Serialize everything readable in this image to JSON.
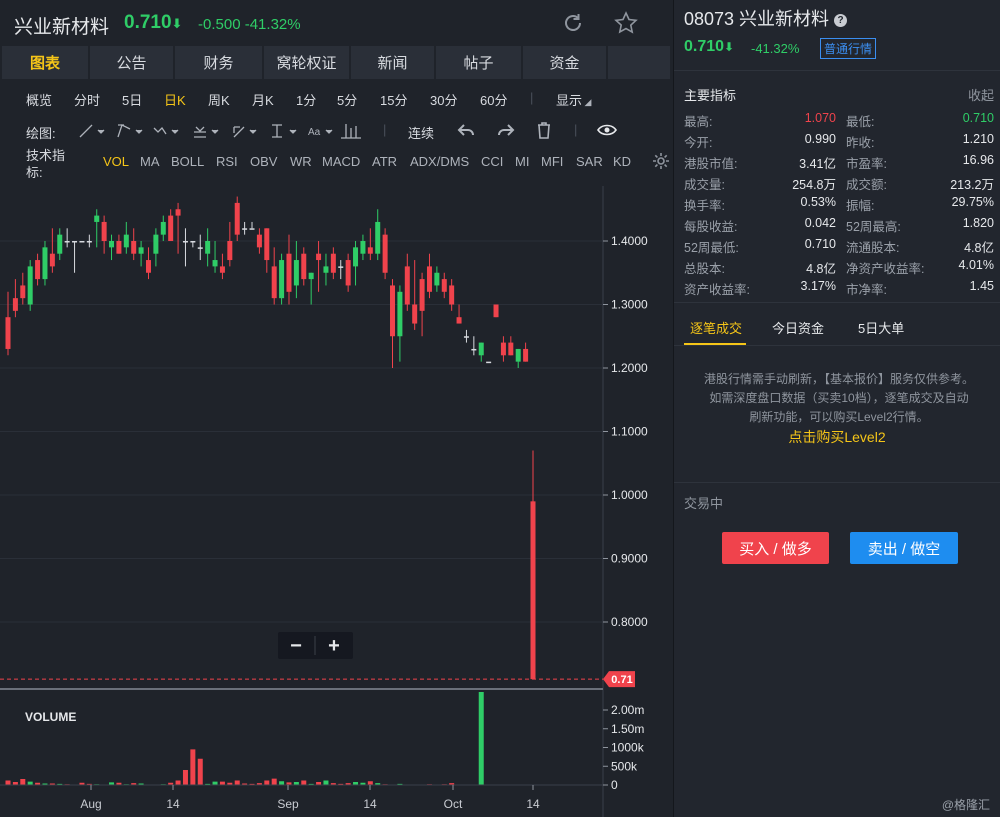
{
  "header": {
    "name": "兴业新材料",
    "price": "0.710",
    "price_arrow": "⬇",
    "change": "-0.500",
    "change_pct": "-41.32%"
  },
  "tabs": [
    {
      "label": "图表",
      "active": true
    },
    {
      "label": "公告"
    },
    {
      "label": "财务"
    },
    {
      "label": "窝轮权证"
    },
    {
      "label": "新闻"
    },
    {
      "label": "帖子"
    },
    {
      "label": "资金"
    }
  ],
  "periods": [
    {
      "label": "概览"
    },
    {
      "label": "分时"
    },
    {
      "label": "5日"
    },
    {
      "label": "日K",
      "active": true
    },
    {
      "label": "周K"
    },
    {
      "label": "月K"
    },
    {
      "label": "1分"
    },
    {
      "label": "5分"
    },
    {
      "label": "15分"
    },
    {
      "label": "30分"
    },
    {
      "label": "60分"
    },
    {
      "label": "显示"
    }
  ],
  "draw": {
    "label": "绘图:",
    "continuous": "连续"
  },
  "indicators": {
    "label": "技术指标:",
    "items": [
      "VOL",
      "MA",
      "BOLL",
      "RSI",
      "OBV",
      "WR",
      "MACD",
      "ATR",
      "ADX/DMS",
      "CCI",
      "MI",
      "MFI",
      "SAR",
      "KD"
    ],
    "active": "VOL"
  },
  "chart_data": {
    "type": "candlestick",
    "price_axis": {
      "ticks": [
        "1.4000",
        "1.3000",
        "1.2000",
        "1.1000",
        "1.0000",
        "0.9000",
        "0.8000"
      ],
      "values": [
        1.4,
        1.3,
        1.2,
        1.1,
        1.0,
        0.9,
        0.8
      ],
      "last_label": "0.71",
      "last": 0.71
    },
    "volume_axis": {
      "label": "VOLUME",
      "ticks": [
        "2.00m",
        "1.50m",
        "1000k",
        "500k",
        "0"
      ],
      "values": [
        2000000,
        1500000,
        1000000,
        500000,
        0
      ]
    },
    "x_labels": [
      "Aug",
      "14",
      "Sep",
      "14",
      "Oct",
      "14"
    ],
    "zoom": {
      "minus": "−",
      "plus": "+"
    },
    "candles": [
      {
        "o": 1.28,
        "h": 1.32,
        "l": 1.22,
        "c": 1.23
      },
      {
        "o": 1.31,
        "h": 1.34,
        "l": 1.28,
        "c": 1.29
      },
      {
        "o": 1.33,
        "h": 1.35,
        "l": 1.3,
        "c": 1.31
      },
      {
        "o": 1.3,
        "h": 1.37,
        "l": 1.29,
        "c": 1.36
      },
      {
        "o": 1.37,
        "h": 1.38,
        "l": 1.33,
        "c": 1.34
      },
      {
        "o": 1.34,
        "h": 1.4,
        "l": 1.33,
        "c": 1.39
      },
      {
        "o": 1.38,
        "h": 1.42,
        "l": 1.35,
        "c": 1.36
      },
      {
        "o": 1.38,
        "h": 1.42,
        "l": 1.37,
        "c": 1.41
      },
      {
        "o": 1.4,
        "h": 1.42,
        "l": 1.39,
        "c": 1.4
      },
      {
        "o": 1.4,
        "h": 1.4,
        "l": 1.35,
        "c": 1.4
      },
      {
        "o": 1.4,
        "h": 1.4,
        "l": 1.4,
        "c": 1.4
      },
      {
        "o": 1.4,
        "h": 1.41,
        "l": 1.39,
        "c": 1.4
      },
      {
        "o": 1.43,
        "h": 1.45,
        "l": 1.39,
        "c": 1.44
      },
      {
        "o": 1.43,
        "h": 1.44,
        "l": 1.38,
        "c": 1.4
      },
      {
        "o": 1.39,
        "h": 1.41,
        "l": 1.37,
        "c": 1.4
      },
      {
        "o": 1.4,
        "h": 1.41,
        "l": 1.38,
        "c": 1.38
      },
      {
        "o": 1.39,
        "h": 1.43,
        "l": 1.38,
        "c": 1.41
      },
      {
        "o": 1.4,
        "h": 1.42,
        "l": 1.37,
        "c": 1.38
      },
      {
        "o": 1.38,
        "h": 1.4,
        "l": 1.36,
        "c": 1.39
      },
      {
        "o": 1.37,
        "h": 1.39,
        "l": 1.34,
        "c": 1.35
      },
      {
        "o": 1.38,
        "h": 1.42,
        "l": 1.36,
        "c": 1.41
      },
      {
        "o": 1.41,
        "h": 1.44,
        "l": 1.4,
        "c": 1.43
      },
      {
        "o": 1.44,
        "h": 1.45,
        "l": 1.4,
        "c": 1.4
      },
      {
        "o": 1.45,
        "h": 1.46,
        "l": 1.38,
        "c": 1.44
      },
      {
        "o": 1.4,
        "h": 1.42,
        "l": 1.36,
        "c": 1.4
      },
      {
        "o": 1.4,
        "h": 1.4,
        "l": 1.39,
        "c": 1.4
      },
      {
        "o": 1.39,
        "h": 1.41,
        "l": 1.37,
        "c": 1.39
      },
      {
        "o": 1.38,
        "h": 1.42,
        "l": 1.36,
        "c": 1.4
      },
      {
        "o": 1.36,
        "h": 1.4,
        "l": 1.35,
        "c": 1.37
      },
      {
        "o": 1.36,
        "h": 1.38,
        "l": 1.34,
        "c": 1.35
      },
      {
        "o": 1.4,
        "h": 1.43,
        "l": 1.36,
        "c": 1.37
      },
      {
        "o": 1.46,
        "h": 1.47,
        "l": 1.4,
        "c": 1.41
      },
      {
        "o": 1.42,
        "h": 1.43,
        "l": 1.41,
        "c": 1.42
      },
      {
        "o": 1.42,
        "h": 1.43,
        "l": 1.42,
        "c": 1.42
      },
      {
        "o": 1.41,
        "h": 1.42,
        "l": 1.38,
        "c": 1.39
      },
      {
        "o": 1.42,
        "h": 1.42,
        "l": 1.35,
        "c": 1.37
      },
      {
        "o": 1.36,
        "h": 1.39,
        "l": 1.3,
        "c": 1.31
      },
      {
        "o": 1.31,
        "h": 1.38,
        "l": 1.3,
        "c": 1.37
      },
      {
        "o": 1.38,
        "h": 1.41,
        "l": 1.3,
        "c": 1.32
      },
      {
        "o": 1.33,
        "h": 1.4,
        "l": 1.31,
        "c": 1.37
      },
      {
        "o": 1.38,
        "h": 1.39,
        "l": 1.33,
        "c": 1.34
      },
      {
        "o": 1.34,
        "h": 1.35,
        "l": 1.3,
        "c": 1.35
      },
      {
        "o": 1.38,
        "h": 1.4,
        "l": 1.32,
        "c": 1.37
      },
      {
        "o": 1.35,
        "h": 1.38,
        "l": 1.33,
        "c": 1.36
      },
      {
        "o": 1.38,
        "h": 1.39,
        "l": 1.34,
        "c": 1.35
      },
      {
        "o": 1.36,
        "h": 1.37,
        "l": 1.34,
        "c": 1.36
      },
      {
        "o": 1.37,
        "h": 1.38,
        "l": 1.32,
        "c": 1.33
      },
      {
        "o": 1.36,
        "h": 1.4,
        "l": 1.33,
        "c": 1.39
      },
      {
        "o": 1.38,
        "h": 1.41,
        "l": 1.37,
        "c": 1.4
      },
      {
        "o": 1.39,
        "h": 1.42,
        "l": 1.37,
        "c": 1.38
      },
      {
        "o": 1.38,
        "h": 1.45,
        "l": 1.37,
        "c": 1.43
      },
      {
        "o": 1.41,
        "h": 1.42,
        "l": 1.34,
        "c": 1.35
      },
      {
        "o": 1.33,
        "h": 1.34,
        "l": 1.2,
        "c": 1.25
      },
      {
        "o": 1.25,
        "h": 1.33,
        "l": 1.21,
        "c": 1.32
      },
      {
        "o": 1.36,
        "h": 1.38,
        "l": 1.29,
        "c": 1.3
      },
      {
        "o": 1.3,
        "h": 1.37,
        "l": 1.26,
        "c": 1.27
      },
      {
        "o": 1.34,
        "h": 1.35,
        "l": 1.25,
        "c": 1.29
      },
      {
        "o": 1.36,
        "h": 1.38,
        "l": 1.31,
        "c": 1.32
      },
      {
        "o": 1.33,
        "h": 1.36,
        "l": 1.32,
        "c": 1.35
      },
      {
        "o": 1.34,
        "h": 1.35,
        "l": 1.31,
        "c": 1.32
      },
      {
        "o": 1.33,
        "h": 1.34,
        "l": 1.29,
        "c": 1.3
      },
      {
        "o": 1.28,
        "h": 1.3,
        "l": 1.27,
        "c": 1.27
      },
      {
        "o": 1.25,
        "h": 1.26,
        "l": 1.24,
        "c": 1.25
      },
      {
        "o": 1.23,
        "h": 1.25,
        "l": 1.22,
        "c": 1.23
      },
      {
        "o": 1.22,
        "h": 1.24,
        "l": 1.21,
        "c": 1.24
      },
      {
        "o": 1.21,
        "h": 1.21,
        "l": 1.21,
        "c": 1.21
      },
      {
        "o": 1.3,
        "h": 1.3,
        "l": 1.28,
        "c": 1.28
      },
      {
        "o": 1.24,
        "h": 1.25,
        "l": 1.21,
        "c": 1.22
      },
      {
        "o": 1.24,
        "h": 1.25,
        "l": 1.22,
        "c": 1.22
      },
      {
        "o": 1.21,
        "h": 1.23,
        "l": 1.2,
        "c": 1.23
      },
      {
        "o": 1.23,
        "h": 1.24,
        "l": 1.21,
        "c": 1.21
      },
      {
        "o": 0.99,
        "h": 1.07,
        "l": 0.71,
        "c": 0.71
      }
    ],
    "volumes": [
      120000,
      80000,
      160000,
      90000,
      60000,
      40000,
      40000,
      30000,
      20000,
      0,
      60000,
      30000,
      20000,
      10000,
      70000,
      60000,
      20000,
      50000,
      40000,
      10000,
      10000,
      20000,
      60000,
      120000,
      400000,
      950000,
      700000,
      30000,
      90000,
      90000,
      60000,
      120000,
      40000,
      30000,
      50000,
      120000,
      170000,
      100000,
      70000,
      80000,
      120000,
      30000,
      80000,
      120000,
      50000,
      30000,
      50000,
      80000,
      60000,
      100000,
      50000,
      20000,
      10000,
      30000,
      0,
      0,
      0,
      20000,
      0,
      20000,
      50000,
      0,
      0,
      0,
      2800000
    ]
  },
  "right": {
    "code": "08073 兴业新材料",
    "price": "0.710",
    "price_arrow": "⬇",
    "change_pct": "-41.32%",
    "badge": "普通行情",
    "section_title": "主要指标",
    "collapse": "收起",
    "metrics": [
      {
        "k1": "最高:",
        "v1": "1.070",
        "c1": "red",
        "k2": "最低:",
        "v2": "0.710",
        "c2": "green"
      },
      {
        "k1": "今开:",
        "v1": "0.990",
        "k2": "昨收:",
        "v2": "1.210"
      },
      {
        "k1": "港股市值:",
        "v1": "3.41亿",
        "k2": "市盈率:",
        "v2": "16.96"
      },
      {
        "k1": "成交量:",
        "v1": "254.8万",
        "k2": "成交额:",
        "v2": "213.2万"
      },
      {
        "k1": "换手率:",
        "v1": "0.53%",
        "k2": "振幅:",
        "v2": "29.75%"
      },
      {
        "k1": "每股收益:",
        "v1": "0.042",
        "k2": "52周最高:",
        "v2": "1.820"
      },
      {
        "k1": "52周最低:",
        "v1": "0.710",
        "k2": "流通股本:",
        "v2": "4.8亿"
      },
      {
        "k1": "总股本:",
        "v1": "4.8亿",
        "k2": "净资产收益率:",
        "v2": "4.01%"
      },
      {
        "k1": "资产收益率:",
        "v1": "3.17%",
        "k2": "市净率:",
        "v2": "1.45"
      }
    ],
    "tabs": [
      "逐笔成交",
      "今日资金",
      "5日大单"
    ],
    "note": "港股行情需手动刷新，【基本报价】服务仅供参考。如需深度盘口数据（买卖10档），逐笔成交及自动刷新功能，可以购买Level2行情。",
    "level2": "点击购买Level2",
    "status": "交易中",
    "buy": "买入 / 做多",
    "sell": "卖出 / 做空",
    "credit": "@格隆汇"
  },
  "colors": {
    "up": "#f0434c",
    "down": "#2fcd67",
    "accent": "#f5c518",
    "blue": "#1e8df0"
  }
}
